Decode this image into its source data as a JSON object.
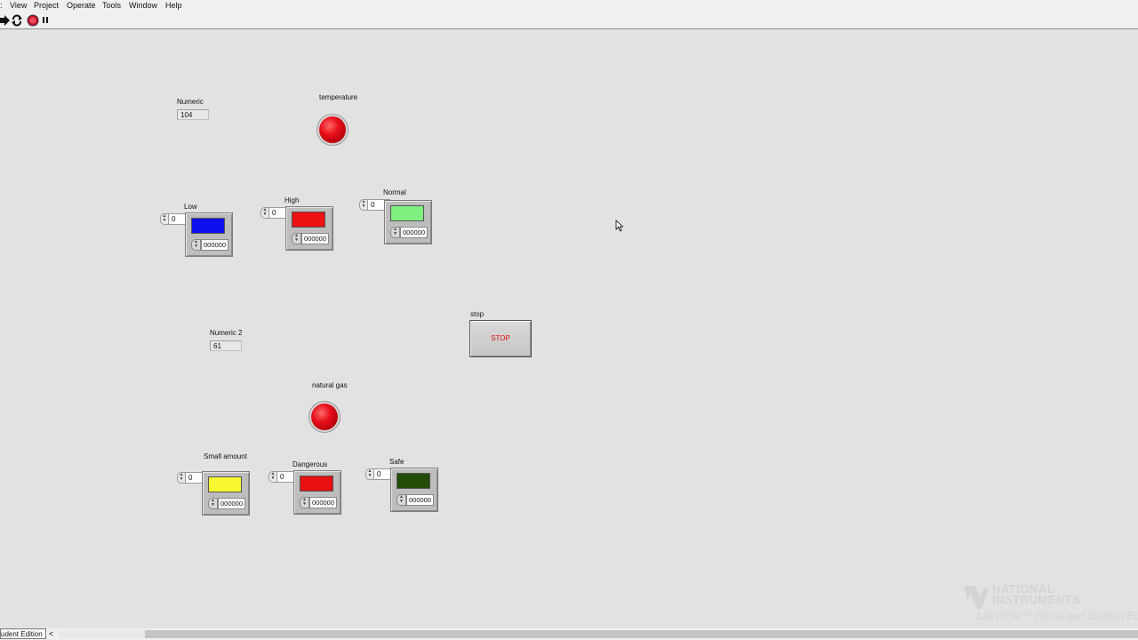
{
  "menubar": {
    "items": [
      "View",
      "Project",
      "Operate",
      "Tools",
      "Window",
      "Help"
    ]
  },
  "toolbar": {
    "buttons": [
      "run-icon",
      "run-continuously-icon",
      "abort-icon",
      "pause-icon"
    ]
  },
  "panel": {
    "numeric": {
      "label": "Numeric",
      "value": "104"
    },
    "temperature_led": {
      "label": "temperature",
      "color": "#e8101b"
    },
    "temperature_colors": [
      {
        "label": "Low",
        "spin_value": "0",
        "hex": "000000",
        "swatch": "#1010ef"
      },
      {
        "label": "High",
        "spin_value": "0",
        "hex": "000000",
        "swatch": "#ee1111"
      },
      {
        "label": "Normal",
        "spin_value": "0",
        "hex": "000000",
        "swatch": "#7ff07f"
      }
    ],
    "numeric2": {
      "label": "Numeric 2",
      "value": "61"
    },
    "stop": {
      "label": "stop",
      "button_text": "STOP"
    },
    "natural_gas_led": {
      "label": "natural gas",
      "color": "#e8101b"
    },
    "gas_colors": [
      {
        "label": "Small amount",
        "spin_value": "0",
        "hex": "000000",
        "swatch": "#f7f732"
      },
      {
        "label": "Dangerous",
        "spin_value": "0",
        "hex": "000000",
        "swatch": "#e81010"
      },
      {
        "label": "Safe",
        "spin_value": "0",
        "hex": "000000",
        "swatch": "#234d06"
      }
    ]
  },
  "watermark": {
    "line1": "NATIONAL",
    "line2": "INSTRUMENTS",
    "line3": "LabVIEW™ Home and Student Edi"
  },
  "statusbar": {
    "edition": "udent Edition",
    "scroll_arrow": "<"
  }
}
